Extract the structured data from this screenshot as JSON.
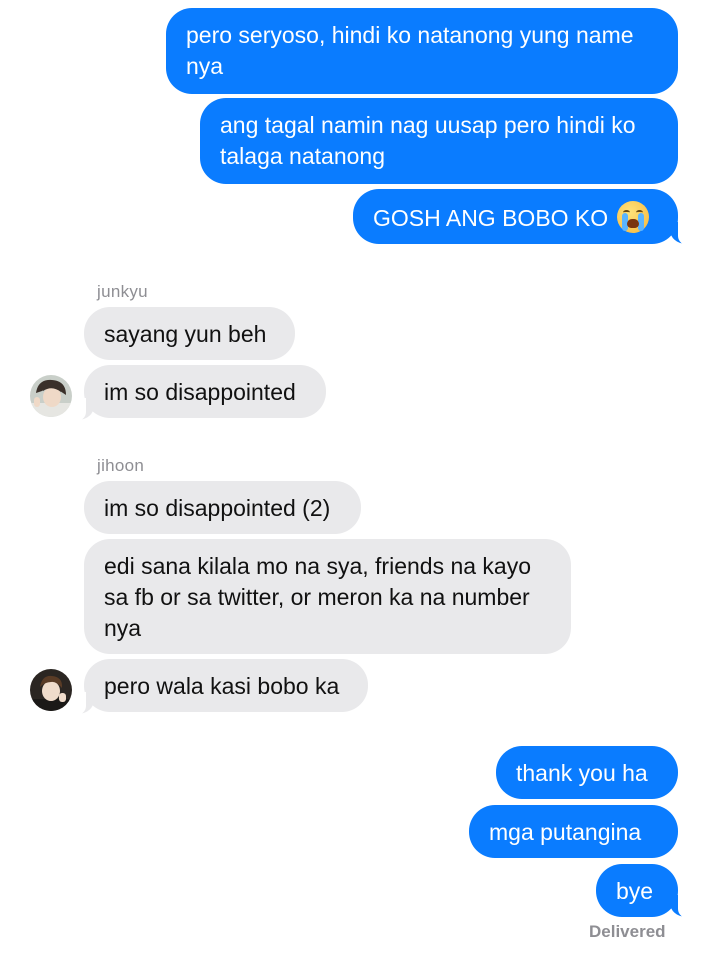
{
  "conversation": {
    "sent_top": [
      "pero seryoso, hindi ko natanong yung name nya",
      "ang tagal namin nag uusap pero hindi ko talaga natanong",
      "GOSH ANG BOBO KO"
    ],
    "sent_top_emoji": "loudly-crying-face-icon",
    "junkyu": {
      "name": "junkyu",
      "messages": [
        "sayang yun beh",
        "im so disappointed"
      ]
    },
    "jihoon": {
      "name": "jihoon",
      "messages": [
        "im so disappointed (2)",
        "edi sana kilala mo na sya, friends na kayo sa fb or sa twitter, or meron ka na number nya",
        "pero wala kasi bobo ka"
      ]
    },
    "sent_bottom": [
      "thank you ha",
      "mga putangina",
      "bye"
    ],
    "status": "Delivered"
  },
  "colors": {
    "outgoing": "#0a7cff",
    "incoming": "#e9e9eb",
    "meta": "#8e8e93"
  }
}
